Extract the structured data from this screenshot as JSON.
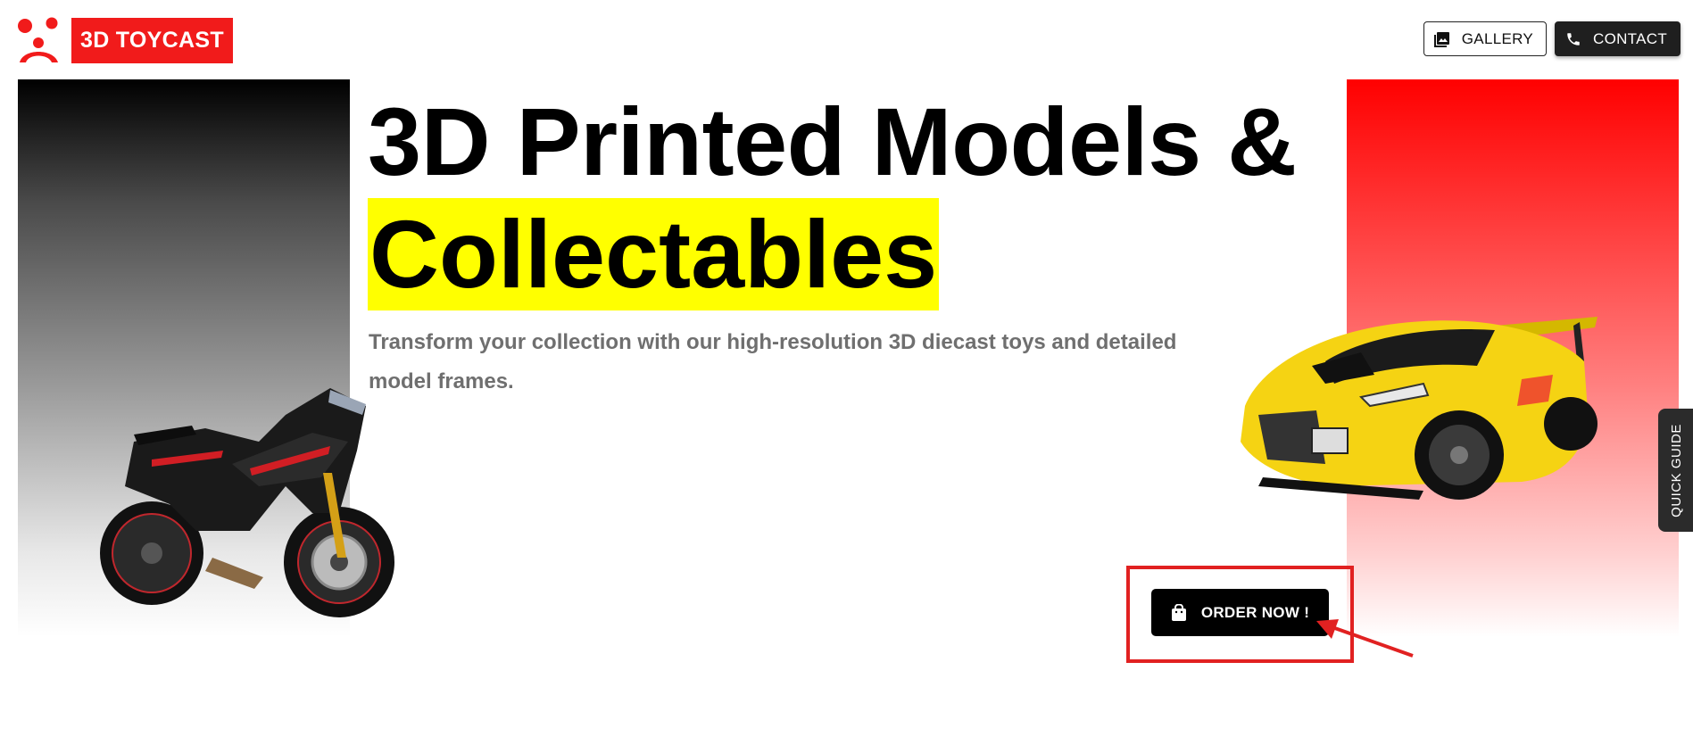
{
  "brand": {
    "name": "3D TOYCAST",
    "color": "#f11b1b"
  },
  "nav": {
    "gallery": {
      "label": "GALLERY",
      "icon": "image-icon"
    },
    "contact": {
      "label": "CONTACT",
      "icon": "phone-icon"
    }
  },
  "hero": {
    "title_line1": "3D Printed Models &",
    "title_line2": "Collectables",
    "highlight_color": "#ffff00",
    "subtitle": "Transform your collection with our high-resolution 3D diecast toys and detailed model frames."
  },
  "cta": {
    "order_label": "ORDER NOW !",
    "icon": "shopping-bag-icon"
  },
  "side_tab": {
    "label": "QUICK GUIDE"
  }
}
